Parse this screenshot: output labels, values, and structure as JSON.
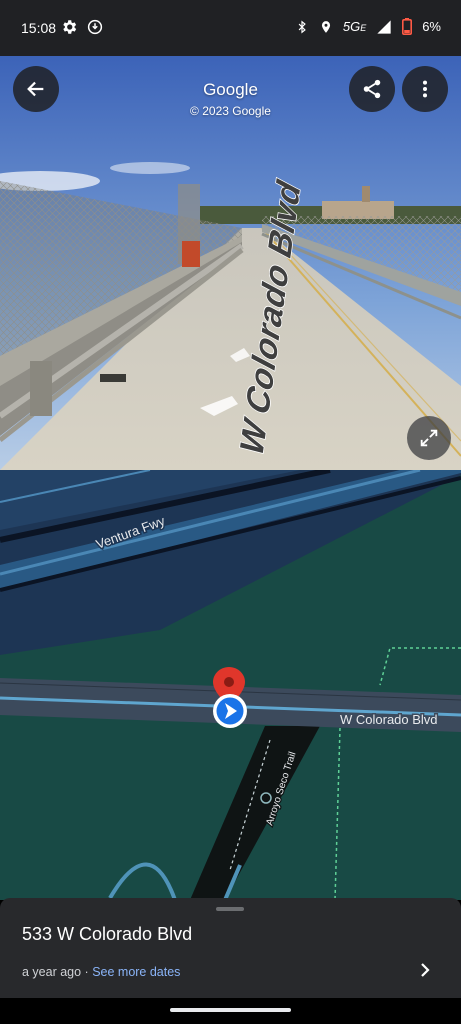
{
  "status_bar": {
    "time": "15:08",
    "network": "5G",
    "network_suffix": "E",
    "battery": "6%",
    "icons": [
      "settings-icon",
      "vpn-icon",
      "bluetooth-icon",
      "location-icon",
      "signal-icon",
      "battery-icon"
    ],
    "battery_color": "#ff5a45"
  },
  "street_view": {
    "title": "Google",
    "copyright": "© 2023 Google",
    "road_label": "W Colorado Blvd",
    "buttons": [
      "back-arrow-icon",
      "share-icon",
      "more-vert-icon",
      "expand-icon"
    ]
  },
  "map": {
    "labels": {
      "ventura": "Ventura Fwy",
      "colorado": "W Colorado Blvd",
      "arroyo": "Arroyo Seco Trail"
    },
    "colors": {
      "land": "#184a45",
      "freeway_area": "#1d3554",
      "road": "#3c4a5c",
      "pin": "#e0362b",
      "location_dot": "#1a73e8"
    }
  },
  "place": {
    "address": "533 W Colorado Blvd",
    "age": "a year ago",
    "separator": " · ",
    "see_more": "See more dates"
  }
}
